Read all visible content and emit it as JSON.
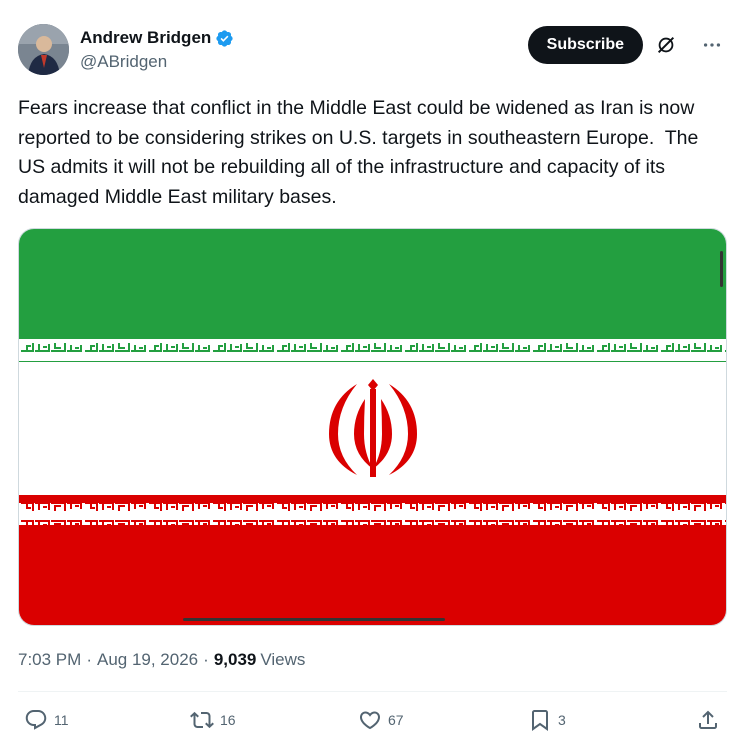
{
  "author": {
    "display_name": "Andrew Bridgen",
    "handle": "@ABridgen"
  },
  "header": {
    "subscribe_label": "Subscribe"
  },
  "tweet": {
    "text": "Fears increase that conflict in the Middle East could be widened as Iran is now reported to be considering strikes on U.S. targets in southeastern Europe.  The US admits it will not be rebuilding all of the infrastructure and capacity of its damaged Middle East military bases."
  },
  "meta": {
    "time": "7:03 PM",
    "date": "Aug 19, 2026",
    "views_count": "9,039",
    "views_label": "Views",
    "separator": "·"
  },
  "actions": {
    "replies": "11",
    "reposts": "16",
    "likes": "67",
    "bookmarks": "3"
  },
  "colors": {
    "flag_green": "#239f40",
    "flag_white": "#ffffff",
    "flag_red": "#da0000",
    "verified_blue": "#1d9bf0"
  },
  "icons": [
    "verified-badge-icon",
    "grok-icon",
    "more-icon",
    "reply-icon",
    "repost-icon",
    "like-icon",
    "bookmark-icon",
    "share-icon"
  ]
}
